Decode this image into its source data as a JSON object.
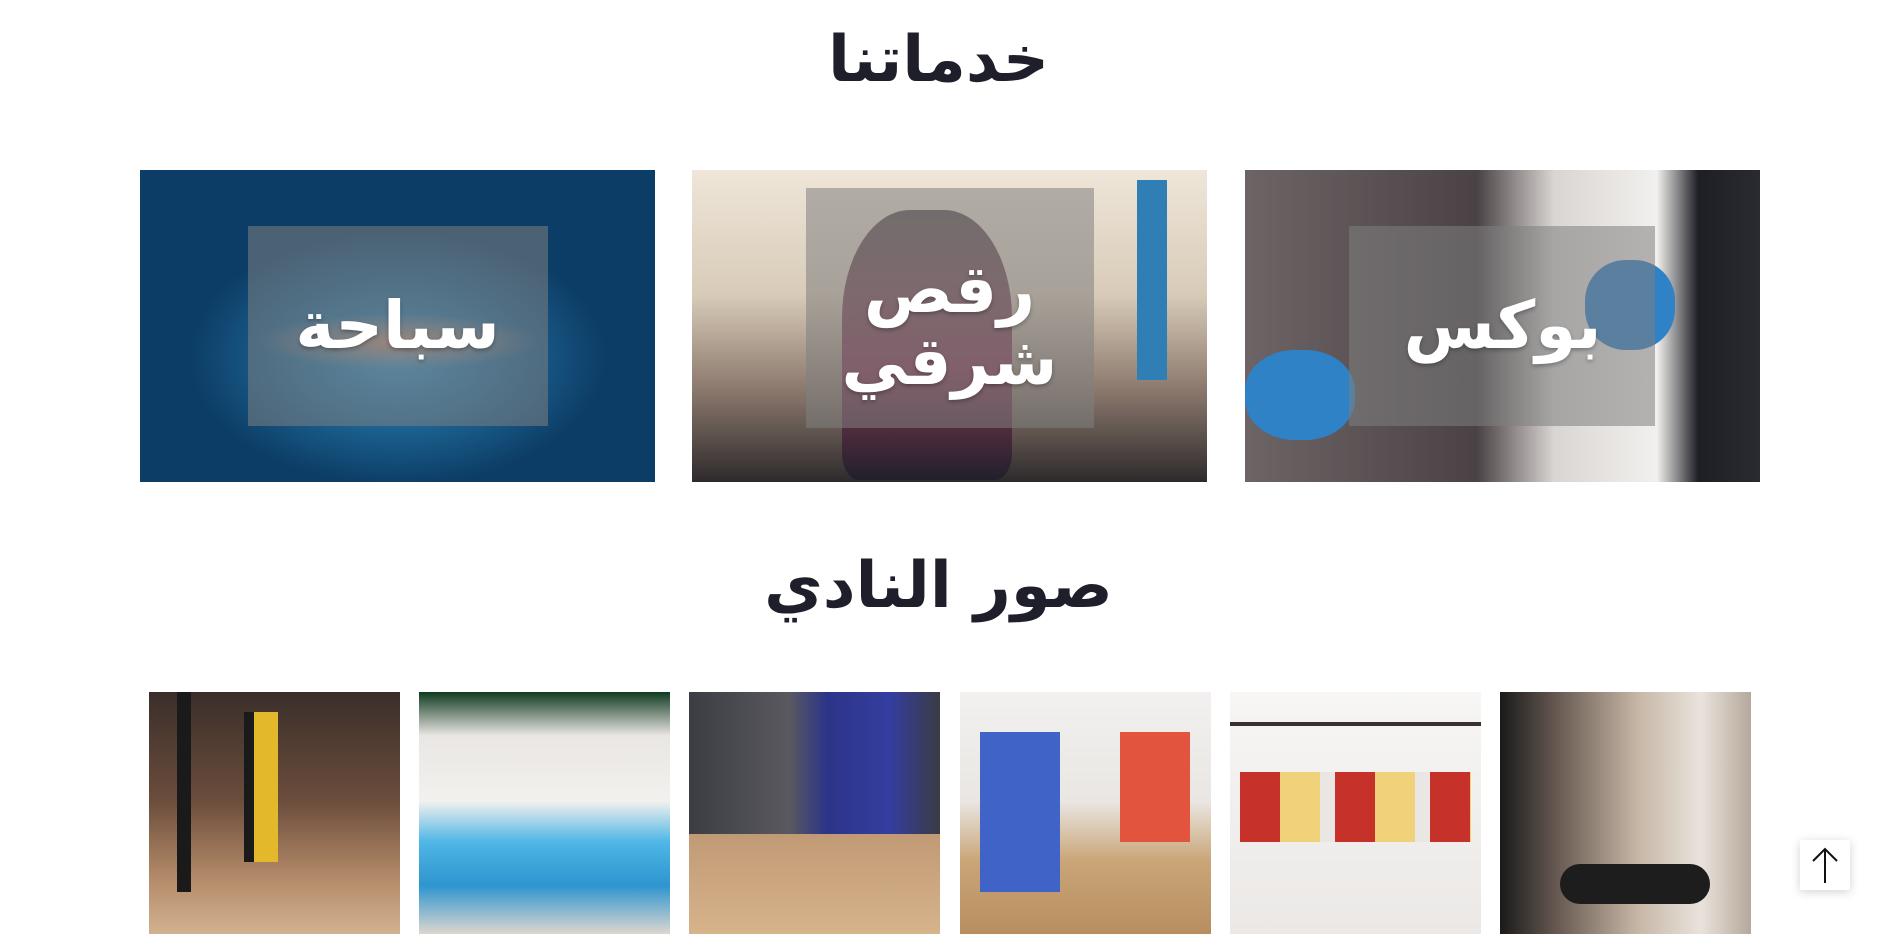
{
  "services": {
    "title": "خدماتنا",
    "cards": [
      {
        "label": "سباحة"
      },
      {
        "label": "رقص\nشرقي"
      },
      {
        "label": "بوكس"
      }
    ]
  },
  "gallery": {
    "title": "صور النادي",
    "photos": [
      {
        "subject": "suspension-training-straps"
      },
      {
        "subject": "indoor-swimming-pool"
      },
      {
        "subject": "gym-equipment-room"
      },
      {
        "subject": "kids-play-area"
      },
      {
        "subject": "supplement-shelves"
      },
      {
        "subject": "stretching-woman"
      }
    ]
  },
  "scroll_top": {
    "icon": "arrow-up-icon"
  }
}
